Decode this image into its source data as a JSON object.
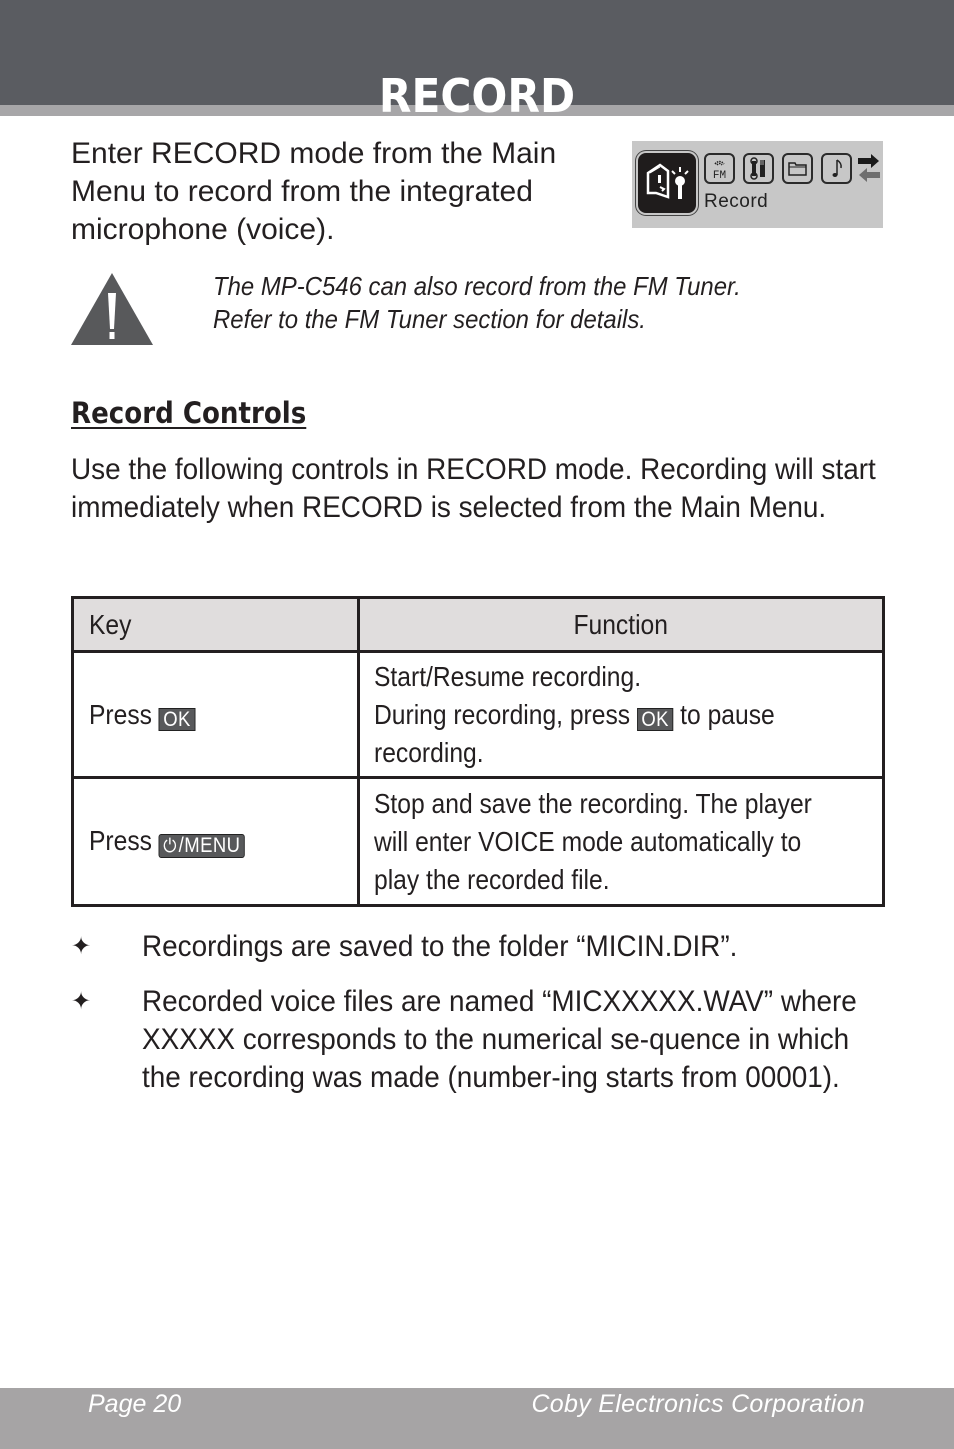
{
  "header": {
    "title": "RECORD",
    "band_color": "#5a5c61",
    "strip_color": "#a7a6a8"
  },
  "intro": {
    "text": "Enter RECORD mode from the Main Menu to record from the integrated microphone (voice)."
  },
  "device_screen": {
    "selected_label": "Record",
    "icons": [
      "record-icon",
      "fm-radio-icon",
      "settings-tools-icon",
      "folder-icon",
      "music-note-icon",
      "navigate-arrows-icon"
    ],
    "fm_text": "FM"
  },
  "note": {
    "icon": "warning-icon",
    "line1": "The MP-C546 can also record from the FM Tuner.",
    "line2": "Refer to the FM Tuner section for details."
  },
  "section": {
    "heading": "Record Controls",
    "body": "Use the following controls in RECORD mode. Recording will start immediately when RECORD is selected from the Main Menu."
  },
  "table": {
    "headers": {
      "key": "Key",
      "function": "Function"
    },
    "rows": [
      {
        "key_prefix": "Press",
        "key_cap": "OK",
        "function_lines": [
          "Start/Resume recording.",
          "During recording, press",
          "to pause",
          "recording."
        ],
        "inline_key_cap": "OK"
      },
      {
        "key_prefix": "Press",
        "key_cap_icon": "power-icon",
        "key_cap": "/MENU",
        "function_lines": [
          "Stop and save the recording. The player",
          "will enter VOICE mode automatically to",
          "play the recorded file."
        ]
      }
    ]
  },
  "bullets": [
    "Recordings are saved to the folder “MICIN.DIR”.",
    "Recorded voice files are named “MICXXXXX.WAV” where XXXXX corresponds to the numerical se-quence in which the recording was made (number-ing starts from 00001)."
  ],
  "bullet_glyph": "✦",
  "footer": {
    "page": "Page 20",
    "company": "Coby Electronics Corporation",
    "color": "#a6a4a5"
  }
}
